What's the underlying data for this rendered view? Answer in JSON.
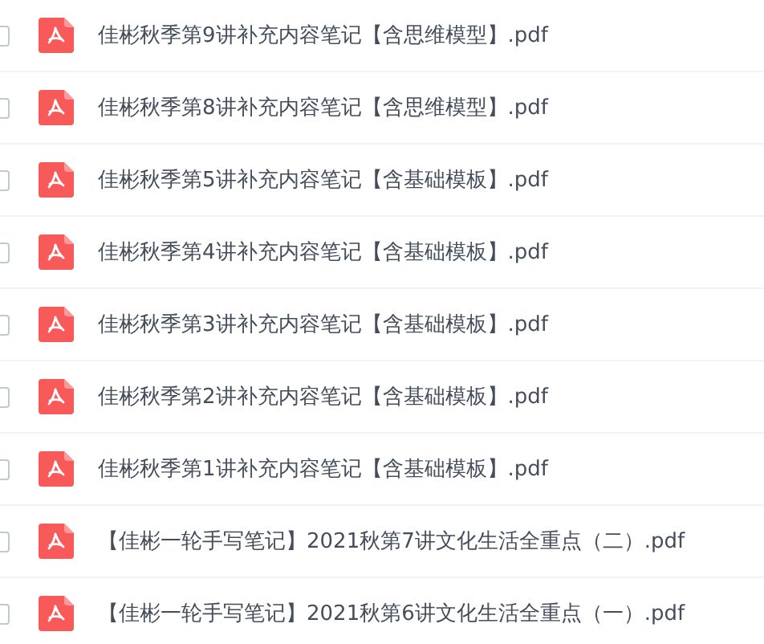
{
  "files": [
    {
      "name": "佳彬秋季第9讲补充内容笔记【含思维模型】.pdf",
      "checked": false
    },
    {
      "name": "佳彬秋季第8讲补充内容笔记【含思维模型】.pdf",
      "checked": false
    },
    {
      "name": "佳彬秋季第5讲补充内容笔记【含基础模板】.pdf",
      "checked": false
    },
    {
      "name": "佳彬秋季第4讲补充内容笔记【含基础模板】.pdf",
      "checked": false
    },
    {
      "name": "佳彬秋季第3讲补充内容笔记【含基础模板】.pdf",
      "checked": false
    },
    {
      "name": "佳彬秋季第2讲补充内容笔记【含基础模板】.pdf",
      "checked": false
    },
    {
      "name": "佳彬秋季第1讲补充内容笔记【含基础模板】.pdf",
      "checked": false
    },
    {
      "name": "【佳彬一轮手写笔记】2021秋第7讲文化生活全重点（二）.pdf",
      "checked": false
    },
    {
      "name": "【佳彬一轮手写笔记】2021秋第6讲文化生活全重点（一）.pdf",
      "checked": false
    }
  ]
}
